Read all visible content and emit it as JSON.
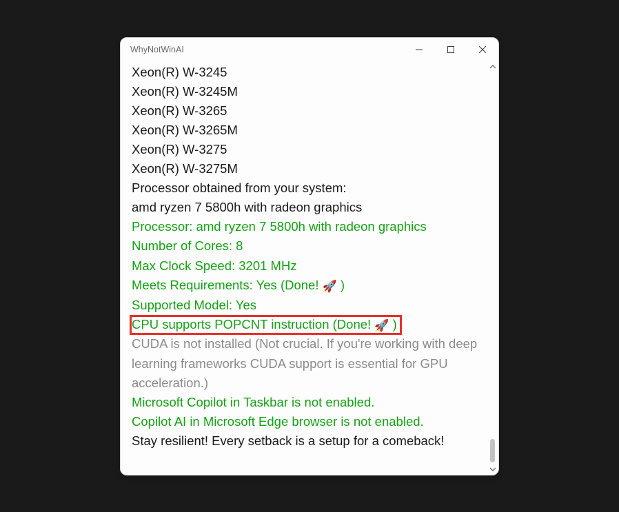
{
  "window": {
    "title": "WhyNotWinAI"
  },
  "lines": {
    "l0": "Xeon(R) W-3245",
    "l1": "Xeon(R) W-3245M",
    "l2": "Xeon(R) W-3265",
    "l3": "Xeon(R) W-3265M",
    "l4": "Xeon(R) W-3275",
    "l5": "Xeon(R) W-3275M",
    "l6": "Processor obtained from your system:",
    "l7": "amd ryzen 7 5800h with radeon graphics",
    "l8": "Processor: amd ryzen 7 5800h with radeon graphics",
    "l9": "Number of Cores: 8",
    "l10": "Max Clock Speed: 3201 MHz",
    "l11a": "Meets Requirements: Yes (Done! ",
    "l11b": " )",
    "l12": "Supported Model: Yes",
    "l13a": "CPU supports POPCNT instruction (Done! ",
    "l13b": " )",
    "l14": "CUDA is not installed (Not crucial. If you're working with deep learning frameworks CUDA support is essential for GPU acceleration.)",
    "l15": "Microsoft Copilot in Taskbar is not enabled.",
    "l16": "Copilot AI in Microsoft Edge browser is not enabled.",
    "l17": "Stay resilient! Every setback is a setup for a comeback!"
  },
  "icons": {
    "rocket": "🚀"
  }
}
